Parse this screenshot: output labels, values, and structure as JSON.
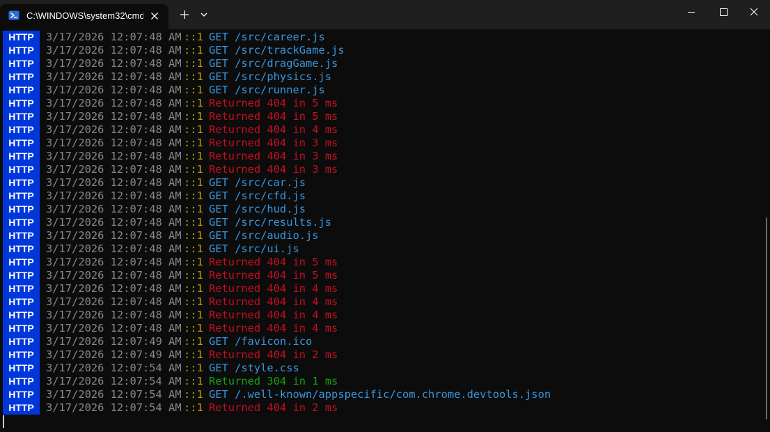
{
  "window": {
    "tab_title": "C:\\WINDOWS\\system32\\cmd.",
    "tab_icon": "powershell-terminal-icon",
    "new_tab_icon": "plus-icon",
    "dropdown_icon": "chevron-down-icon",
    "minimize_icon": "minimize-icon",
    "maximize_icon": "maximize-icon",
    "close_icon": "close-icon"
  },
  "colors": {
    "background": "#0c0c0c",
    "titlebar": "#1f1f1f",
    "badge_bg": "#0037da",
    "timestamp": "#888888",
    "address": "#c19c00",
    "get": "#3a96dd",
    "error": "#c50f1f",
    "success": "#13a10e"
  },
  "log": [
    {
      "badge": "HTTP",
      "ts": "3/17/2026 12:07:48 AM",
      "ip": "::1",
      "type": "get",
      "msg": "GET /src/career.js"
    },
    {
      "badge": "HTTP",
      "ts": "3/17/2026 12:07:48 AM",
      "ip": "::1",
      "type": "get",
      "msg": "GET /src/trackGame.js"
    },
    {
      "badge": "HTTP",
      "ts": "3/17/2026 12:07:48 AM",
      "ip": "::1",
      "type": "get",
      "msg": "GET /src/dragGame.js"
    },
    {
      "badge": "HTTP",
      "ts": "3/17/2026 12:07:48 AM",
      "ip": "::1",
      "type": "get",
      "msg": "GET /src/physics.js"
    },
    {
      "badge": "HTTP",
      "ts": "3/17/2026 12:07:48 AM",
      "ip": "::1",
      "type": "get",
      "msg": "GET /src/runner.js"
    },
    {
      "badge": "HTTP",
      "ts": "3/17/2026 12:07:48 AM",
      "ip": "::1",
      "type": "err",
      "msg": "Returned 404 in 5 ms"
    },
    {
      "badge": "HTTP",
      "ts": "3/17/2026 12:07:48 AM",
      "ip": "::1",
      "type": "err",
      "msg": "Returned 404 in 5 ms"
    },
    {
      "badge": "HTTP",
      "ts": "3/17/2026 12:07:48 AM",
      "ip": "::1",
      "type": "err",
      "msg": "Returned 404 in 4 ms"
    },
    {
      "badge": "HTTP",
      "ts": "3/17/2026 12:07:48 AM",
      "ip": "::1",
      "type": "err",
      "msg": "Returned 404 in 3 ms"
    },
    {
      "badge": "HTTP",
      "ts": "3/17/2026 12:07:48 AM",
      "ip": "::1",
      "type": "err",
      "msg": "Returned 404 in 3 ms"
    },
    {
      "badge": "HTTP",
      "ts": "3/17/2026 12:07:48 AM",
      "ip": "::1",
      "type": "err",
      "msg": "Returned 404 in 3 ms"
    },
    {
      "badge": "HTTP",
      "ts": "3/17/2026 12:07:48 AM",
      "ip": "::1",
      "type": "get",
      "msg": "GET /src/car.js"
    },
    {
      "badge": "HTTP",
      "ts": "3/17/2026 12:07:48 AM",
      "ip": "::1",
      "type": "get",
      "msg": "GET /src/cfd.js"
    },
    {
      "badge": "HTTP",
      "ts": "3/17/2026 12:07:48 AM",
      "ip": "::1",
      "type": "get",
      "msg": "GET /src/hud.js"
    },
    {
      "badge": "HTTP",
      "ts": "3/17/2026 12:07:48 AM",
      "ip": "::1",
      "type": "get",
      "msg": "GET /src/results.js"
    },
    {
      "badge": "HTTP",
      "ts": "3/17/2026 12:07:48 AM",
      "ip": "::1",
      "type": "get",
      "msg": "GET /src/audio.js"
    },
    {
      "badge": "HTTP",
      "ts": "3/17/2026 12:07:48 AM",
      "ip": "::1",
      "type": "get",
      "msg": "GET /src/ui.js"
    },
    {
      "badge": "HTTP",
      "ts": "3/17/2026 12:07:48 AM",
      "ip": "::1",
      "type": "err",
      "msg": "Returned 404 in 5 ms"
    },
    {
      "badge": "HTTP",
      "ts": "3/17/2026 12:07:48 AM",
      "ip": "::1",
      "type": "err",
      "msg": "Returned 404 in 5 ms"
    },
    {
      "badge": "HTTP",
      "ts": "3/17/2026 12:07:48 AM",
      "ip": "::1",
      "type": "err",
      "msg": "Returned 404 in 4 ms"
    },
    {
      "badge": "HTTP",
      "ts": "3/17/2026 12:07:48 AM",
      "ip": "::1",
      "type": "err",
      "msg": "Returned 404 in 4 ms"
    },
    {
      "badge": "HTTP",
      "ts": "3/17/2026 12:07:48 AM",
      "ip": "::1",
      "type": "err",
      "msg": "Returned 404 in 4 ms"
    },
    {
      "badge": "HTTP",
      "ts": "3/17/2026 12:07:48 AM",
      "ip": "::1",
      "type": "err",
      "msg": "Returned 404 in 4 ms"
    },
    {
      "badge": "HTTP",
      "ts": "3/17/2026 12:07:49 AM",
      "ip": "::1",
      "type": "get",
      "msg": "GET /favicon.ico"
    },
    {
      "badge": "HTTP",
      "ts": "3/17/2026 12:07:49 AM",
      "ip": "::1",
      "type": "err",
      "msg": "Returned 404 in 2 ms"
    },
    {
      "badge": "HTTP",
      "ts": "3/17/2026 12:07:54 AM",
      "ip": "::1",
      "type": "get",
      "msg": "GET /style.css"
    },
    {
      "badge": "HTTP",
      "ts": "3/17/2026 12:07:54 AM",
      "ip": "::1",
      "type": "ok",
      "msg": "Returned 304 in 1 ms"
    },
    {
      "badge": "HTTP",
      "ts": "3/17/2026 12:07:54 AM",
      "ip": "::1",
      "type": "get",
      "msg": "GET /.well-known/appspecific/com.chrome.devtools.json"
    },
    {
      "badge": "HTTP",
      "ts": "3/17/2026 12:07:54 AM",
      "ip": "::1",
      "type": "err",
      "msg": "Returned 404 in 2 ms"
    }
  ]
}
